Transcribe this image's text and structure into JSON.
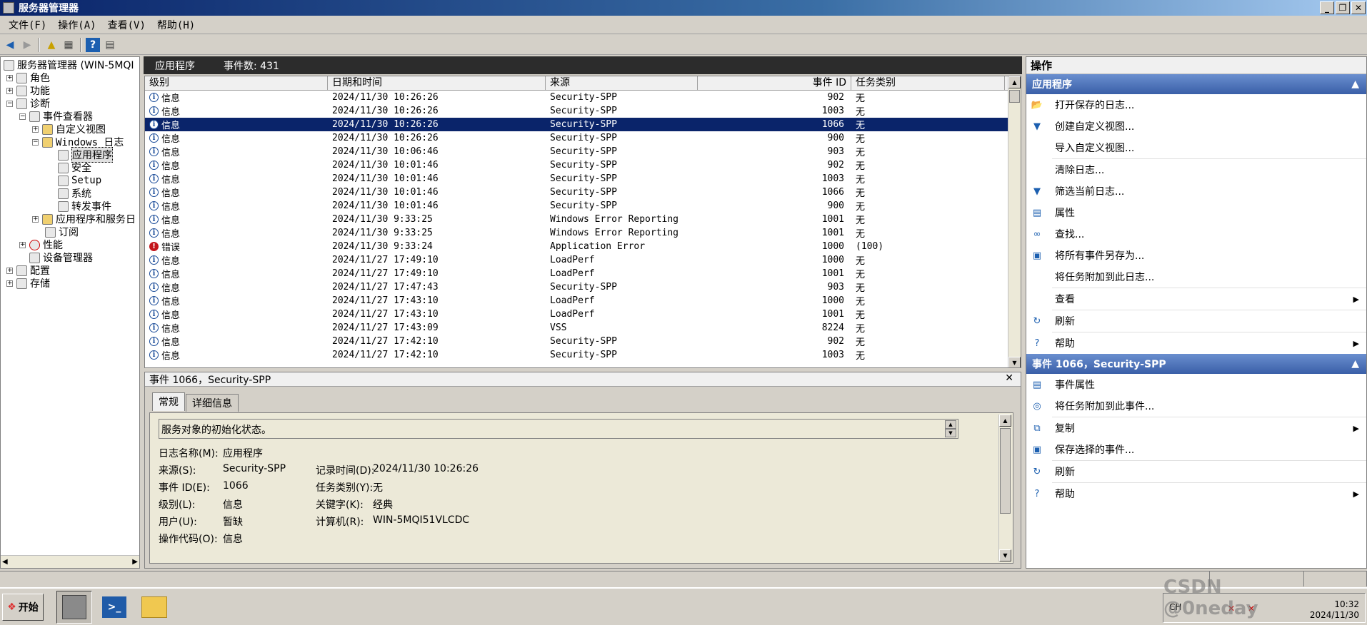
{
  "window": {
    "title": "服务器管理器",
    "min": "_",
    "max": "❐",
    "close": "✕"
  },
  "menu": [
    "文件(F)",
    "操作(A)",
    "查看(V)",
    "帮助(H)"
  ],
  "tree": {
    "root": "服务器管理器 (WIN-5MQI",
    "roles": "角色",
    "features": "功能",
    "diagnostics": "诊断",
    "event_viewer": "事件查看器",
    "custom_views": "自定义视图",
    "windows_logs": "Windows 日志",
    "application": "应用程序",
    "security": "安全",
    "setup": "Setup",
    "system": "系统",
    "forwarded": "转发事件",
    "apps_services": "应用程序和服务日",
    "subscriptions": "订阅",
    "performance": "性能",
    "device_manager": "设备管理器",
    "configuration": "配置",
    "storage": "存储"
  },
  "list": {
    "title": "应用程序",
    "count_label": "事件数: 431",
    "columns": [
      "级别",
      "日期和时间",
      "来源",
      "事件 ID",
      "任务类别"
    ],
    "rows": [
      {
        "level": "信息",
        "type": "info",
        "date": "2024/11/30 10:26:26",
        "source": "Security-SPP",
        "id": "902",
        "task": "无"
      },
      {
        "level": "信息",
        "type": "info",
        "date": "2024/11/30 10:26:26",
        "source": "Security-SPP",
        "id": "1003",
        "task": "无"
      },
      {
        "level": "信息",
        "type": "info",
        "date": "2024/11/30 10:26:26",
        "source": "Security-SPP",
        "id": "1066",
        "task": "无",
        "selected": true
      },
      {
        "level": "信息",
        "type": "info",
        "date": "2024/11/30 10:26:26",
        "source": "Security-SPP",
        "id": "900",
        "task": "无"
      },
      {
        "level": "信息",
        "type": "info",
        "date": "2024/11/30 10:06:46",
        "source": "Security-SPP",
        "id": "903",
        "task": "无"
      },
      {
        "level": "信息",
        "type": "info",
        "date": "2024/11/30 10:01:46",
        "source": "Security-SPP",
        "id": "902",
        "task": "无"
      },
      {
        "level": "信息",
        "type": "info",
        "date": "2024/11/30 10:01:46",
        "source": "Security-SPP",
        "id": "1003",
        "task": "无"
      },
      {
        "level": "信息",
        "type": "info",
        "date": "2024/11/30 10:01:46",
        "source": "Security-SPP",
        "id": "1066",
        "task": "无"
      },
      {
        "level": "信息",
        "type": "info",
        "date": "2024/11/30 10:01:46",
        "source": "Security-SPP",
        "id": "900",
        "task": "无"
      },
      {
        "level": "信息",
        "type": "info",
        "date": "2024/11/30 9:33:25",
        "source": "Windows Error Reporting",
        "id": "1001",
        "task": "无"
      },
      {
        "level": "信息",
        "type": "info",
        "date": "2024/11/30 9:33:25",
        "source": "Windows Error Reporting",
        "id": "1001",
        "task": "无"
      },
      {
        "level": "错误",
        "type": "error",
        "date": "2024/11/30 9:33:24",
        "source": "Application Error",
        "id": "1000",
        "task": "(100)"
      },
      {
        "level": "信息",
        "type": "info",
        "date": "2024/11/27 17:49:10",
        "source": "LoadPerf",
        "id": "1000",
        "task": "无"
      },
      {
        "level": "信息",
        "type": "info",
        "date": "2024/11/27 17:49:10",
        "source": "LoadPerf",
        "id": "1001",
        "task": "无"
      },
      {
        "level": "信息",
        "type": "info",
        "date": "2024/11/27 17:47:43",
        "source": "Security-SPP",
        "id": "903",
        "task": "无"
      },
      {
        "level": "信息",
        "type": "info",
        "date": "2024/11/27 17:43:10",
        "source": "LoadPerf",
        "id": "1000",
        "task": "无"
      },
      {
        "level": "信息",
        "type": "info",
        "date": "2024/11/27 17:43:10",
        "source": "LoadPerf",
        "id": "1001",
        "task": "无"
      },
      {
        "level": "信息",
        "type": "info",
        "date": "2024/11/27 17:43:09",
        "source": "VSS",
        "id": "8224",
        "task": "无"
      },
      {
        "level": "信息",
        "type": "info",
        "date": "2024/11/27 17:42:10",
        "source": "Security-SPP",
        "id": "902",
        "task": "无"
      },
      {
        "level": "信息",
        "type": "info",
        "date": "2024/11/27 17:42:10",
        "source": "Security-SPP",
        "id": "1003",
        "task": "无"
      }
    ]
  },
  "detail": {
    "title": "事件 1066，Security-SPP",
    "close": "✕",
    "tabs": [
      "常规",
      "详细信息"
    ],
    "description": "服务对象的初始化状态。",
    "log_name_label": "日志名称(M):",
    "log_name": "应用程序",
    "source_label": "来源(S):",
    "source": "Security-SPP",
    "logged_label": "记录时间(D):",
    "logged": "2024/11/30 10:26:26",
    "event_id_label": "事件 ID(E):",
    "event_id": "1066",
    "task_label": "任务类别(Y):",
    "task": "无",
    "level_label": "级别(L):",
    "level": "信息",
    "keywords_label": "关键字(K):",
    "keywords": "经典",
    "user_label": "用户(U):",
    "user": "暂缺",
    "computer_label": "计算机(R):",
    "computer": "WIN-5MQI51VLCDC",
    "opcode_label": "操作代码(O):",
    "opcode": "信息"
  },
  "actions": {
    "title": "操作",
    "section1": "应用程序",
    "items1": [
      {
        "label": "打开保存的日志...",
        "icon": "folder-open-icon",
        "glyph": "📂"
      },
      {
        "label": "创建自定义视图...",
        "icon": "filter-icon",
        "glyph": "▼"
      },
      {
        "label": "导入自定义视图...",
        "icon": "",
        "glyph": ""
      },
      {
        "label": "清除日志...",
        "icon": "",
        "glyph": ""
      },
      {
        "label": "筛选当前日志...",
        "icon": "filter-icon",
        "glyph": "▼"
      },
      {
        "label": "属性",
        "icon": "properties-icon",
        "glyph": "▤"
      },
      {
        "label": "查找...",
        "icon": "binoculars-icon",
        "glyph": "∞"
      },
      {
        "label": "将所有事件另存为...",
        "icon": "save-icon",
        "glyph": "▣"
      },
      {
        "label": "将任务附加到此日志...",
        "icon": "",
        "glyph": ""
      },
      {
        "label": "查看",
        "icon": "",
        "glyph": "",
        "submenu": true
      },
      {
        "label": "刷新",
        "icon": "refresh-icon",
        "glyph": "↻"
      },
      {
        "label": "帮助",
        "icon": "help-icon",
        "glyph": "?",
        "submenu": true
      }
    ],
    "section2": "事件 1066，Security-SPP",
    "items2": [
      {
        "label": "事件属性",
        "icon": "properties-icon",
        "glyph": "▤"
      },
      {
        "label": "将任务附加到此事件...",
        "icon": "task-icon",
        "glyph": "◎"
      },
      {
        "label": "复制",
        "icon": "copy-icon",
        "glyph": "⧉",
        "submenu": true
      },
      {
        "label": "保存选择的事件...",
        "icon": "save-icon",
        "glyph": "▣"
      },
      {
        "label": "刷新",
        "icon": "refresh-icon",
        "glyph": "↻"
      },
      {
        "label": "帮助",
        "icon": "help-icon",
        "glyph": "?",
        "submenu": true
      }
    ]
  },
  "taskbar": {
    "start": "开始",
    "lang": "CH",
    "clock_time": "10:32",
    "clock_date": "2024/11/30",
    "watermark": "CSDN @0neday"
  }
}
